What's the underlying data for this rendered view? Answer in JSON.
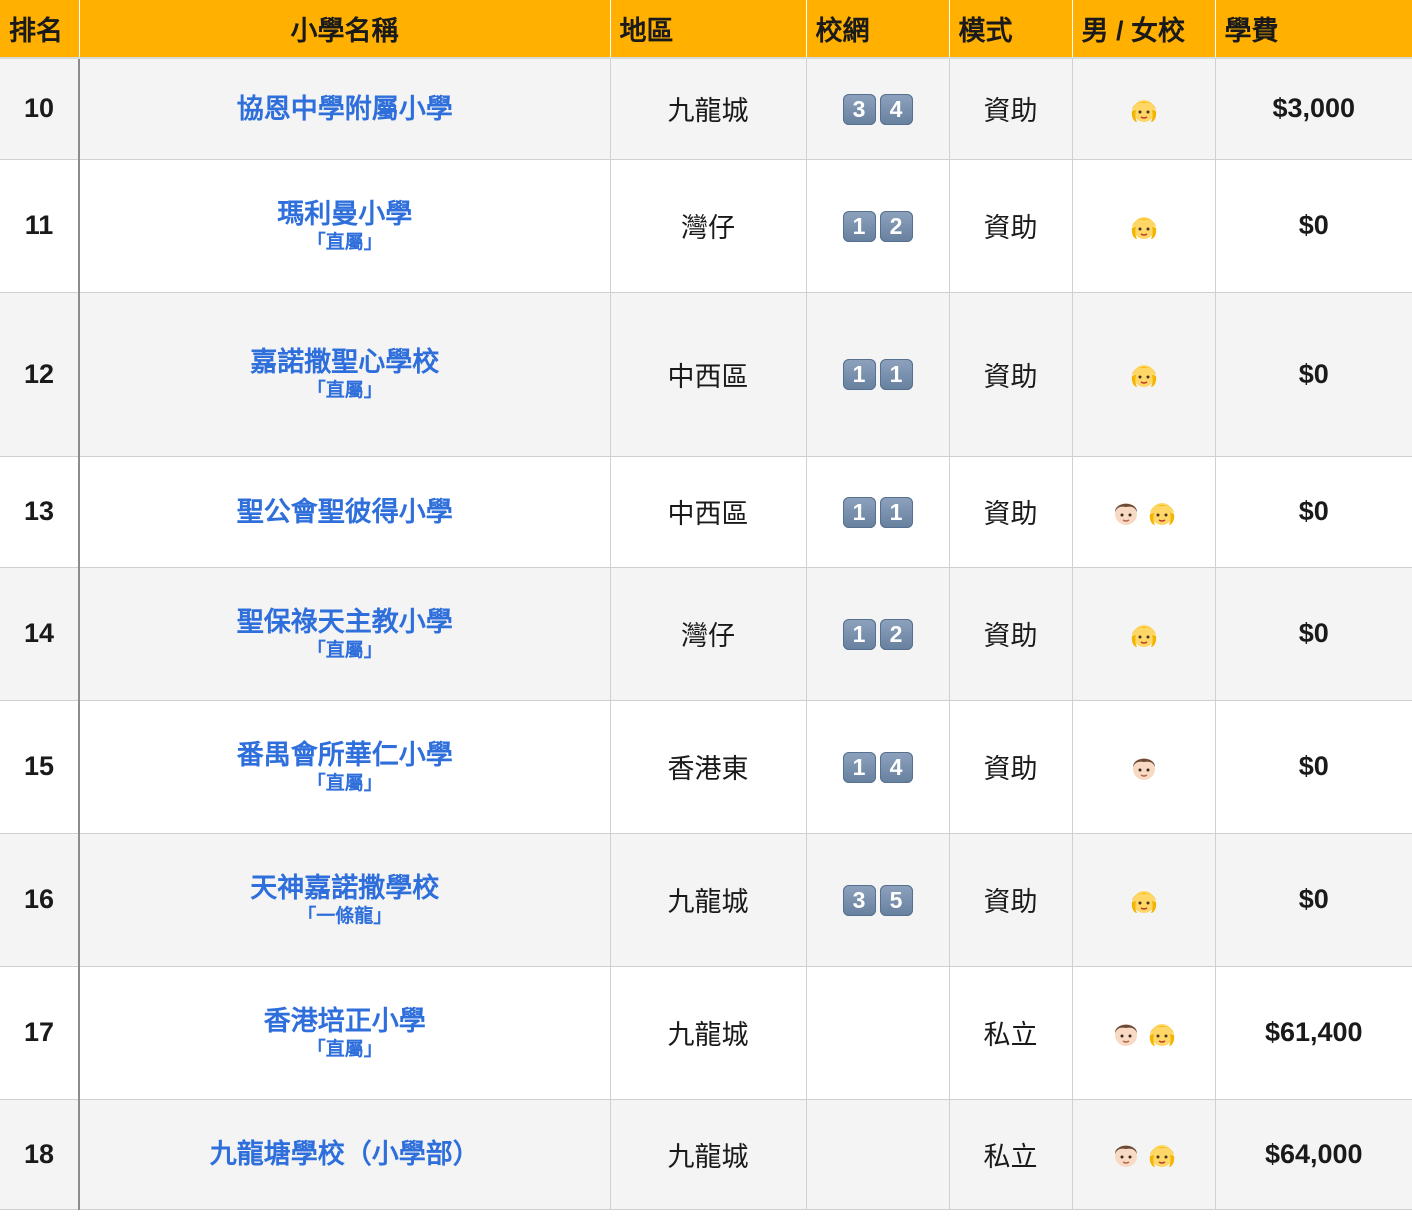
{
  "headers": {
    "rank": "排名",
    "name": "小學名稱",
    "district": "地區",
    "net": "校網",
    "mode": "模式",
    "sex": "男 / 女校",
    "fee": "學費"
  },
  "icons": {
    "girl": "girl-face-icon",
    "boy": "boy-face-icon",
    "net_digit": "keycap-digit-icon"
  },
  "colors": {
    "header_bg": "#FFB000",
    "link_blue": "#2f6fdc",
    "stripe": "#f4f4f4"
  },
  "rows": [
    {
      "rank": "10",
      "name": "協恩中學附屬小學",
      "tag": "",
      "district": "九龍城",
      "net": [
        "3",
        "4"
      ],
      "mode": "資助",
      "sex": [
        "girl"
      ],
      "fee": "$3,000"
    },
    {
      "rank": "11",
      "name": "瑪利曼小學",
      "tag": "「直屬」",
      "district": "灣仔",
      "net": [
        "1",
        "2"
      ],
      "mode": "資助",
      "sex": [
        "girl"
      ],
      "fee": "$0"
    },
    {
      "rank": "12",
      "name": "嘉諾撒聖心學校",
      "tag": "「直屬」",
      "district": "中西區",
      "net": [
        "1",
        "1"
      ],
      "mode": "資助",
      "sex": [
        "girl"
      ],
      "fee": "$0"
    },
    {
      "rank": "13",
      "name": "聖公會聖彼得小學",
      "tag": "",
      "district": "中西區",
      "net": [
        "1",
        "1"
      ],
      "mode": "資助",
      "sex": [
        "boy",
        "girl"
      ],
      "fee": "$0"
    },
    {
      "rank": "14",
      "name": "聖保祿天主教小學",
      "tag": "「直屬」",
      "district": "灣仔",
      "net": [
        "1",
        "2"
      ],
      "mode": "資助",
      "sex": [
        "girl"
      ],
      "fee": "$0"
    },
    {
      "rank": "15",
      "name": "番禺會所華仁小學",
      "tag": "「直屬」",
      "district": "香港東",
      "net": [
        "1",
        "4"
      ],
      "mode": "資助",
      "sex": [
        "boy"
      ],
      "fee": "$0"
    },
    {
      "rank": "16",
      "name": "天神嘉諾撒學校",
      "tag": "「一條龍」",
      "district": "九龍城",
      "net": [
        "3",
        "5"
      ],
      "mode": "資助",
      "sex": [
        "girl"
      ],
      "fee": "$0"
    },
    {
      "rank": "17",
      "name": "香港培正小學",
      "tag": "「直屬」",
      "district": "九龍城",
      "net": [],
      "mode": "私立",
      "sex": [
        "boy",
        "girl"
      ],
      "fee": "$61,400"
    },
    {
      "rank": "18",
      "name": "九龍塘學校（小學部）",
      "tag": "",
      "district": "九龍城",
      "net": [],
      "mode": "私立",
      "sex": [
        "boy",
        "girl"
      ],
      "fee": "$64,000"
    }
  ]
}
